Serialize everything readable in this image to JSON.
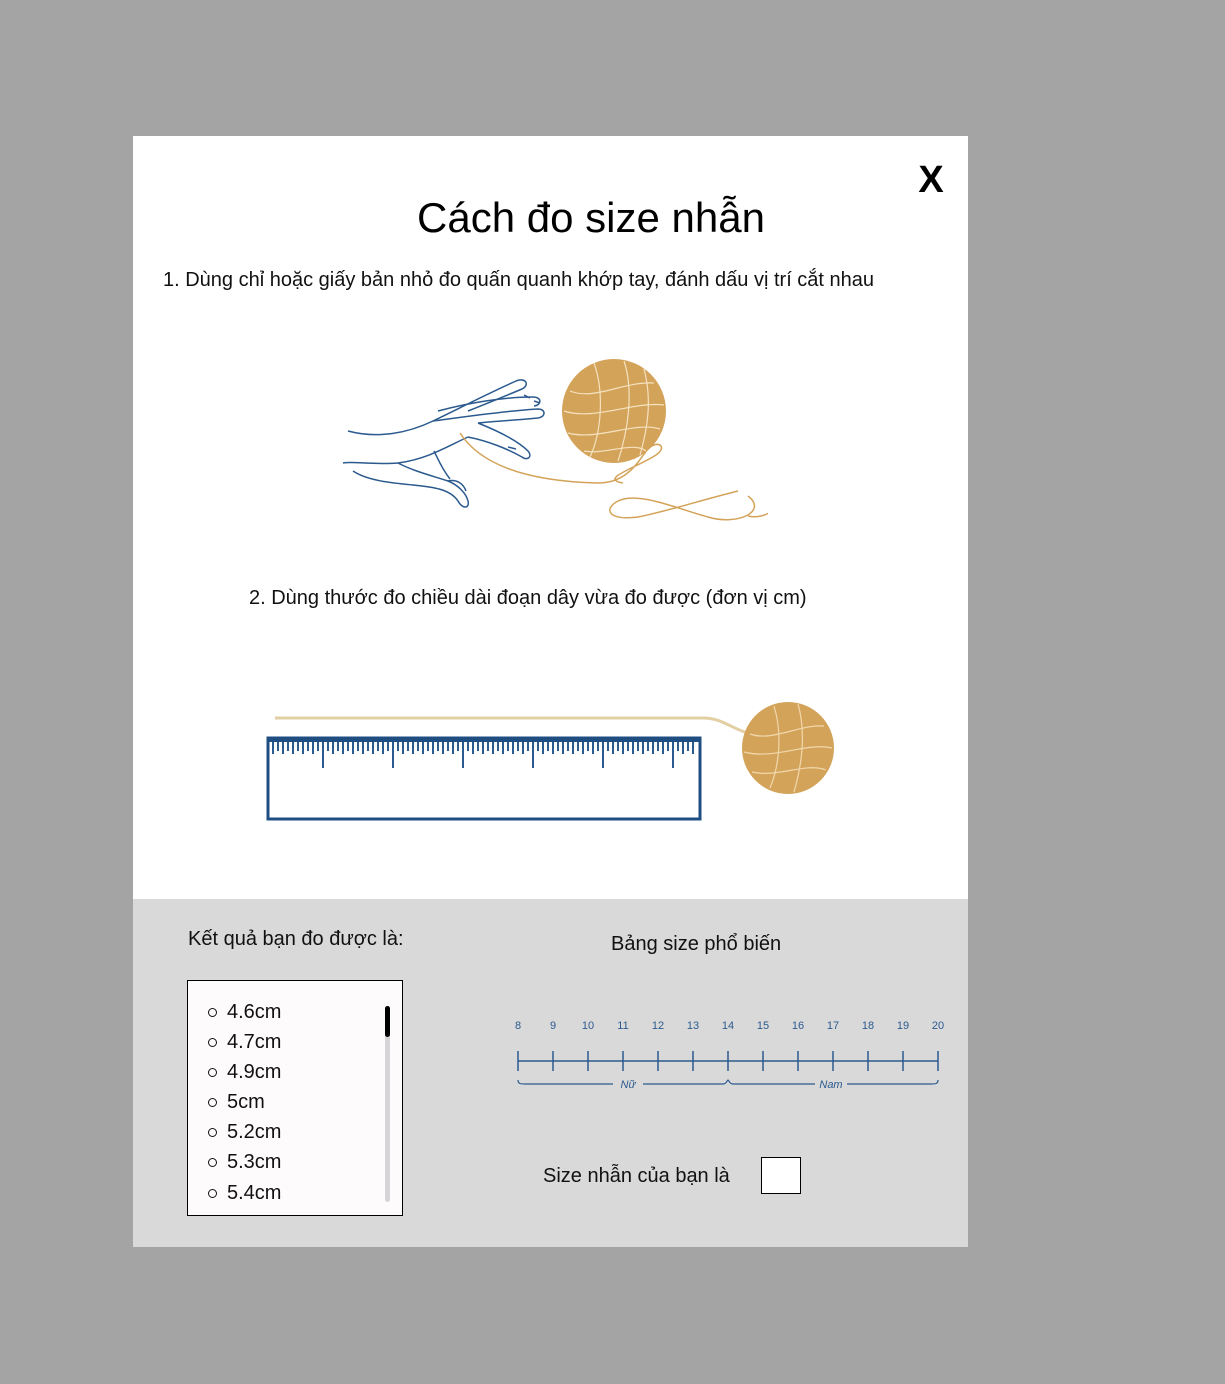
{
  "modal": {
    "close_label": "X",
    "title": "Cách đo size nhẫn",
    "step1": "1. Dùng chỉ hoặc giấy bản nhỏ đo quấn quanh khớp tay, đánh dấu vị trí cắt nhau",
    "step2": "2. Dùng thước đo chiều dài đoạn dây vừa đo được (đơn vị cm)"
  },
  "result": {
    "label": "Kết quả bạn đo được là:",
    "options": [
      "4.6cm",
      "4.7cm",
      "4.9cm",
      "5cm",
      "5.2cm",
      "5.3cm",
      "5.4cm"
    ],
    "scroll_position": 0
  },
  "size_table": {
    "title": "Bảng size phổ biến",
    "ticks": [
      "8",
      "9",
      "10",
      "11",
      "12",
      "13",
      "14",
      "15",
      "16",
      "17",
      "18",
      "19",
      "20"
    ],
    "female_label": "Nữ",
    "male_label": "Nam"
  },
  "size_result": {
    "label": "Size nhẫn của bạn là",
    "value": ""
  },
  "colors": {
    "overlay": "#a4a4a4",
    "navy": "#2b5a8e",
    "gold": "#d4a35a",
    "panel": "#d9d9d9"
  },
  "icons": {
    "close": "close-icon",
    "hand": "hand-illustration",
    "yarn": "yarn-ball-illustration",
    "ruler": "ruler-illustration"
  }
}
